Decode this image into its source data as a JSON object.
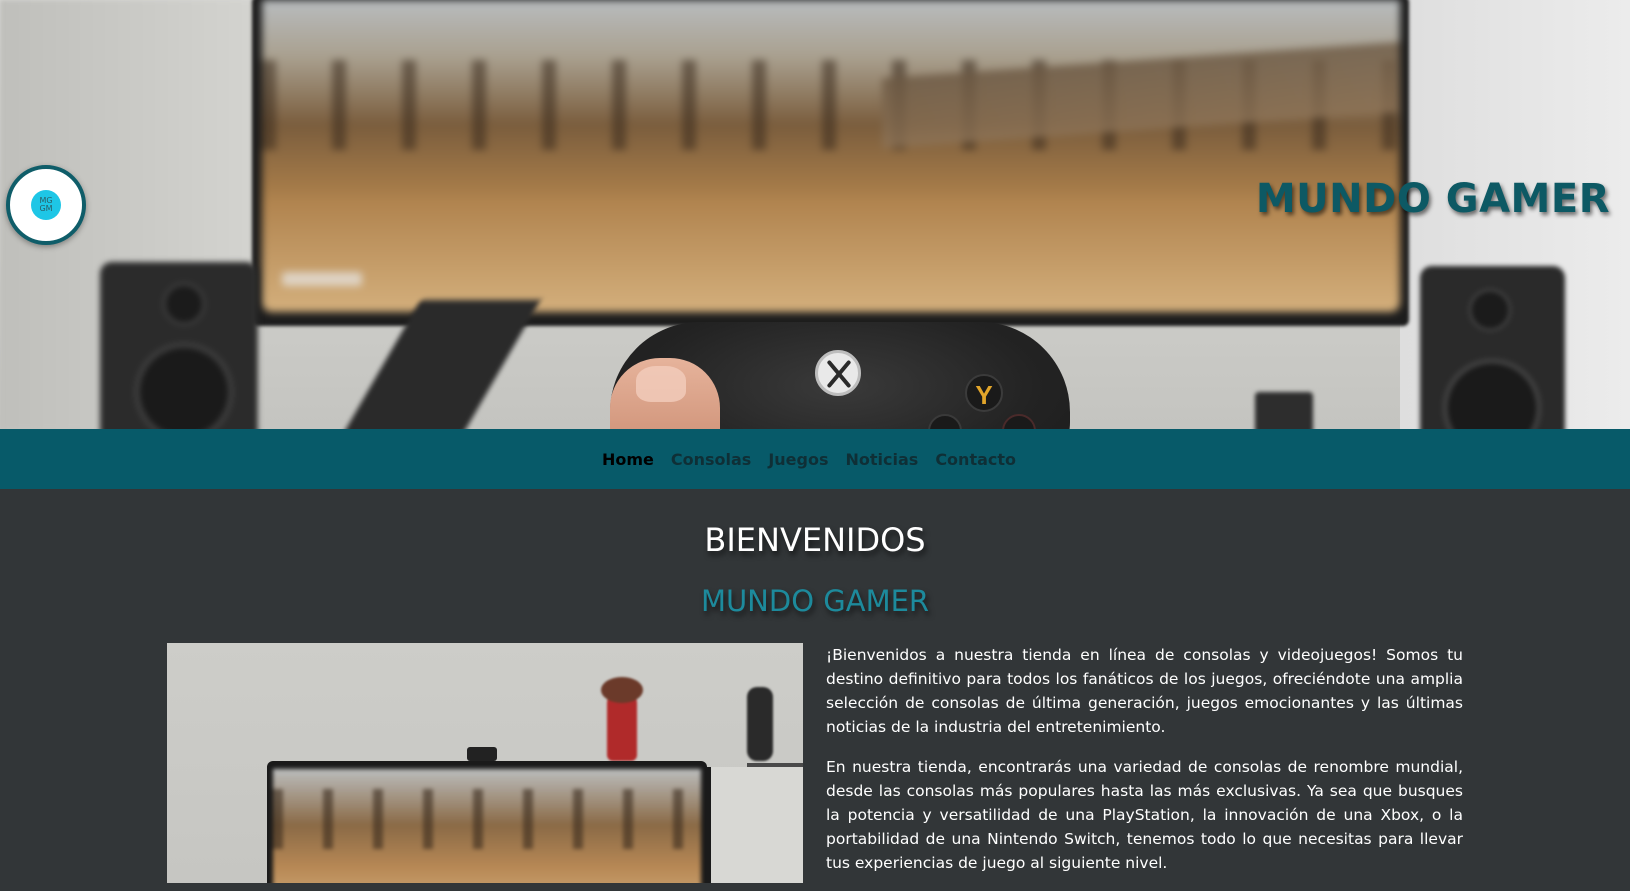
{
  "hero": {
    "logo_text": "MG\nGM",
    "title": "MUNDO GAMER"
  },
  "nav": {
    "items": [
      {
        "label": "Home",
        "active": true
      },
      {
        "label": "Consolas",
        "active": false
      },
      {
        "label": "Juegos",
        "active": false
      },
      {
        "label": "Noticias",
        "active": false
      },
      {
        "label": "Contacto",
        "active": false
      }
    ]
  },
  "main": {
    "heading": "BIENVENIDOS",
    "subheading": "MUNDO GAMER",
    "paragraphs": [
      "¡Bienvenidos a nuestra tienda en línea de consolas y videojuegos! Somos tu destino definitivo para todos los fanáticos de los juegos, ofreciéndote una amplia selección de consolas de última generación, juegos emocionantes y las últimas noticias de la industria del entretenimiento.",
      "En nuestra tienda, encontrarás una variedad de consolas de renombre mundial, desde las consolas más populares hasta las más exclusivas. Ya sea que busques la potencia y versatilidad de una PlayStation, la innovación de una Xbox, o la portabilidad de una Nintendo Switch, tenemos todo lo que necesitas para llevar tus experiencias de juego al siguiente nivel."
    ]
  },
  "colors": {
    "nav_bg": "#075a69",
    "page_bg": "#323638",
    "accent": "#1d8a9c",
    "hero_title": "#0d5964",
    "logo_inner": "#1ec6e6"
  }
}
